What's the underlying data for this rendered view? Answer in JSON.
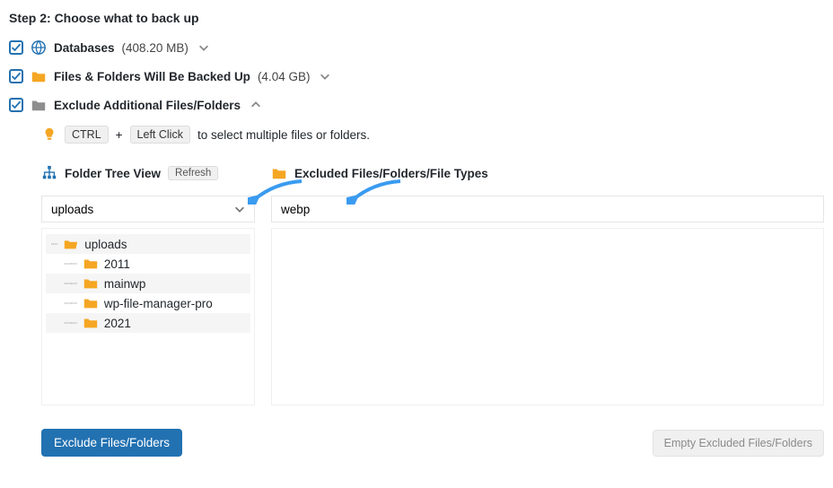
{
  "step_title": "Step 2: Choose what to back up",
  "rows": {
    "databases": {
      "label": "Databases",
      "size": "(408.20 MB)"
    },
    "files": {
      "label": "Files & Folders Will Be Backed Up",
      "size": "(4.04 GB)"
    },
    "exclude": {
      "label": "Exclude Additional Files/Folders"
    }
  },
  "hint": {
    "kbd_ctrl": "CTRL",
    "plus": " + ",
    "kbd_click": "Left Click",
    "tail": "  to select multiple files or folders."
  },
  "left": {
    "header": "Folder Tree View",
    "refresh": "Refresh",
    "select_value": "uploads",
    "tree": {
      "root": "uploads",
      "children": [
        "2011",
        "mainwp",
        "wp-file-manager-pro",
        "2021"
      ]
    }
  },
  "right": {
    "header": "Excluded Files/Folders/File Types",
    "input_value": "webp"
  },
  "buttons": {
    "exclude": "Exclude Files/Folders",
    "empty": "Empty Excluded Files/Folders"
  }
}
